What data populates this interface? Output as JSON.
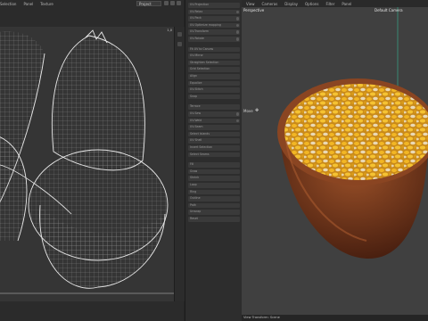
{
  "uv_editor": {
    "menu": [
      "Selection",
      "Panel",
      "Texture"
    ],
    "projection_select": "Project",
    "coord_label": "1,0"
  },
  "tools_panel": {
    "items": [
      {
        "label": "UV-Projection",
        "toggle": false
      },
      {
        "label": "UV-Relax",
        "toggle": true
      },
      {
        "label": "UV-Pack",
        "toggle": true
      },
      {
        "label": "UV-Optimize mapping",
        "toggle": true
      },
      {
        "label": "UV-Transform",
        "toggle": true
      },
      {
        "label": "UV-Rotate",
        "toggle": true
      },
      {
        "label": "Fit UV to Canvas",
        "toggle": false
      },
      {
        "label": "UV-Mirror",
        "toggle": false
      },
      {
        "label": "Straighten Selection",
        "toggle": false
      },
      {
        "label": "Grid Selection",
        "toggle": false
      },
      {
        "label": "Align",
        "toggle": false
      },
      {
        "label": "Equalize",
        "toggle": false
      },
      {
        "label": "UV-Stitch",
        "toggle": false
      },
      {
        "label": "Snap",
        "toggle": false
      },
      {
        "label": "Terrace",
        "toggle": false
      },
      {
        "label": "UV-Sew",
        "toggle": true
      },
      {
        "label": "UV-Weld",
        "toggle": true
      },
      {
        "label": "UV-Seam",
        "toggle": false
      },
      {
        "label": "Select Islands",
        "toggle": false
      },
      {
        "label": "UV Shell",
        "toggle": false
      },
      {
        "label": "Invert Selection",
        "toggle": false
      },
      {
        "label": "Select Seams",
        "toggle": false
      },
      {
        "label": "Fill",
        "toggle": false
      },
      {
        "label": "Grow",
        "toggle": false
      },
      {
        "label": "Shrink",
        "toggle": false
      },
      {
        "label": "Loop",
        "toggle": false
      },
      {
        "label": "Ring",
        "toggle": false
      },
      {
        "label": "Outline",
        "toggle": false
      },
      {
        "label": "Path",
        "toggle": false
      },
      {
        "label": "Unwrap",
        "toggle": false
      },
      {
        "label": "Reset",
        "toggle": false
      }
    ]
  },
  "viewport": {
    "menu": [
      "View",
      "Cameras",
      "Display",
      "Options",
      "Filter",
      "Panel"
    ],
    "view_name": "Perspective",
    "camera_label": "Default Camera",
    "move_label": "Move",
    "status": "View Transform: Scene"
  },
  "colors": {
    "bowl": "#7a3a1a",
    "bowl_rim": "#8e4a24",
    "kernel_yellow": "#f0b020",
    "kernel_cream": "#e8d8b8",
    "viewport_bg": "#404040",
    "uv_lines": "#e8e8e8"
  }
}
